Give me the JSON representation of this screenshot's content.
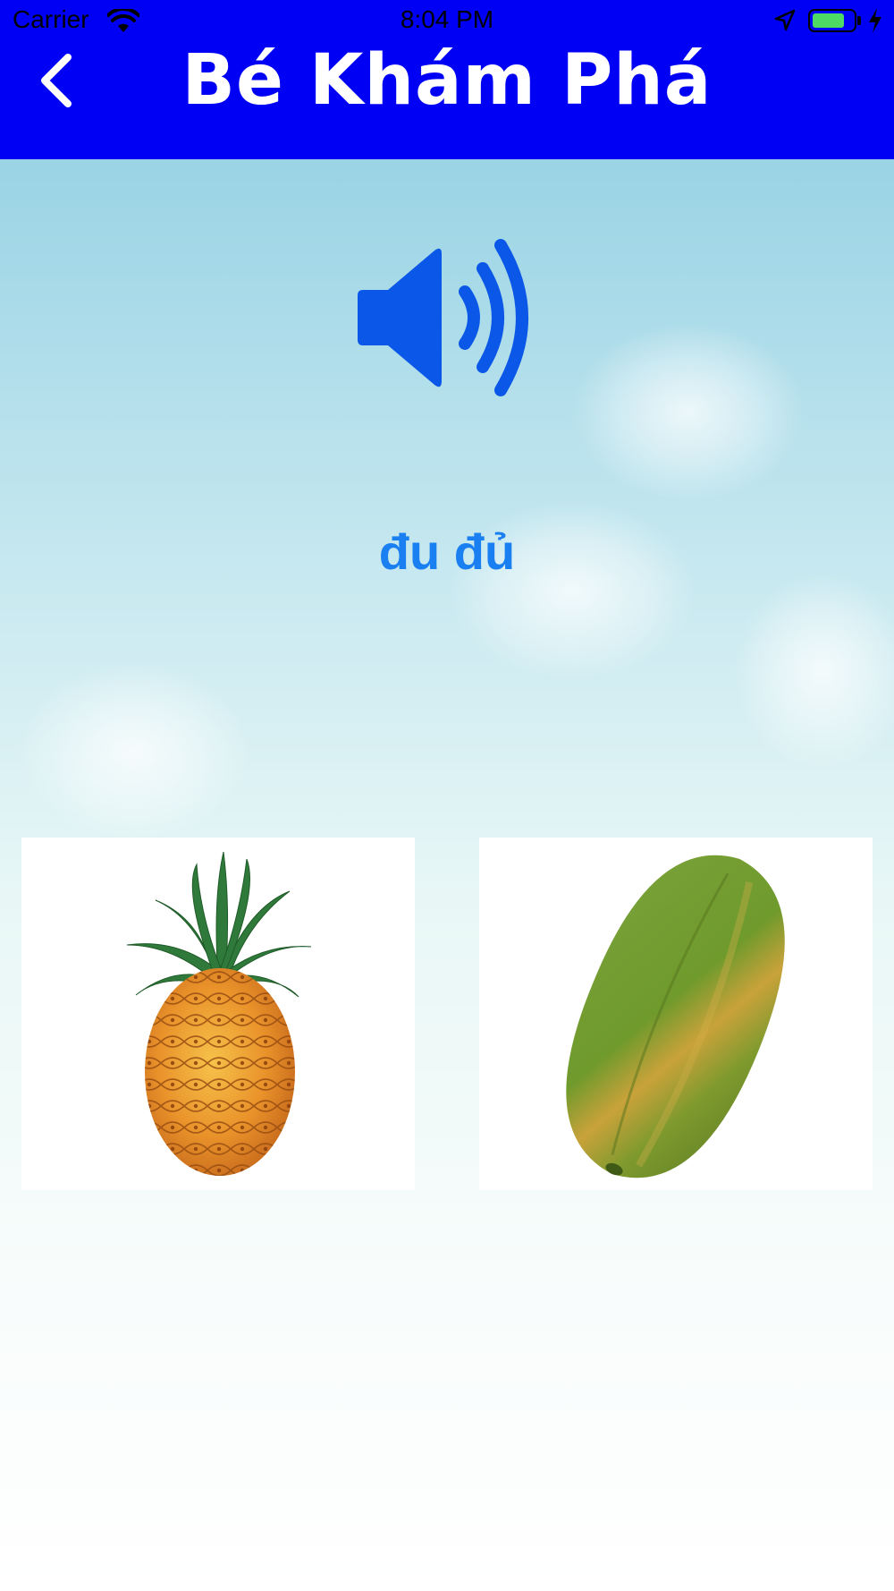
{
  "status_bar": {
    "carrier": "Carrier",
    "time": "8:04 PM",
    "battery_level": 0.8,
    "icons": [
      "wifi-icon",
      "location-arrow-icon",
      "battery-icon",
      "charging-bolt-icon"
    ]
  },
  "header": {
    "title": "Bé Khám Phá",
    "back_icon": "chevron-left-icon",
    "background_color": "#0000f5"
  },
  "speaker": {
    "icon": "speaker-volume-icon",
    "color": "#0b57e8"
  },
  "word": {
    "text": "đu đủ",
    "color": "#1a7ff0"
  },
  "choices": [
    {
      "image": "pineapple"
    },
    {
      "image": "papaya"
    }
  ]
}
